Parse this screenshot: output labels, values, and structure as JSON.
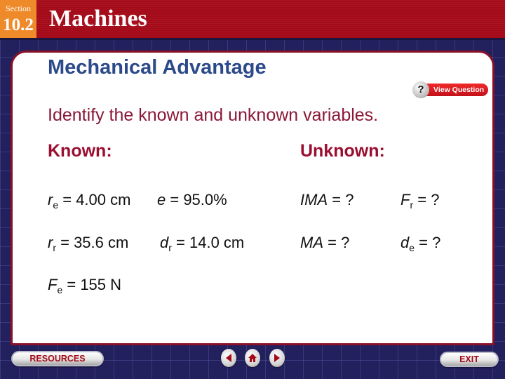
{
  "header": {
    "section_label": "Section",
    "section_number": "10.2",
    "chapter_title": "Machines"
  },
  "slide": {
    "title": "Mechanical Advantage",
    "view_question_label": "View Question",
    "view_question_icon": "?",
    "instruction": "Identify the known and unknown variables.",
    "known_heading": "Known:",
    "unknown_heading": "Unknown:",
    "known": [
      {
        "var": "r",
        "sub": "e",
        "rest": " = 4.00 cm"
      },
      {
        "var": "e",
        "sub": "",
        "rest": " = 95.0%"
      },
      {
        "var": "r",
        "sub": "r",
        "rest": " = 35.6 cm"
      },
      {
        "var": "d",
        "sub": "r",
        "rest": " = 14.0 cm"
      },
      {
        "var": "F",
        "sub": "e",
        "rest": " = 155 N"
      }
    ],
    "unknown": [
      {
        "var": "IMA",
        "sub": "",
        "rest": " = ?"
      },
      {
        "var": "F",
        "sub": "r",
        "rest": " = ?"
      },
      {
        "var": "MA",
        "sub": "",
        "rest": " = ?"
      },
      {
        "var": "d",
        "sub": "e",
        "rest": " = ?"
      }
    ]
  },
  "footer": {
    "resources_label": "RESOURCES",
    "exit_label": "EXIT",
    "nav": [
      "previous",
      "home",
      "next"
    ]
  }
}
